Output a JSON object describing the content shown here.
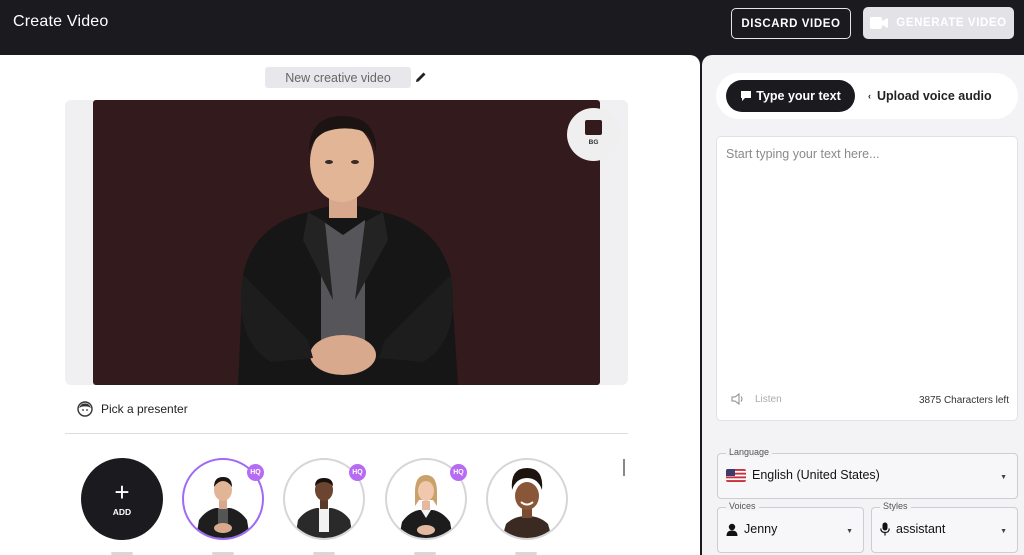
{
  "header": {
    "title": "Create Video",
    "discard_label": "DISCARD VIDEO",
    "generate_label": "GENERATE VIDEO"
  },
  "editor": {
    "video_title": "New creative video",
    "bg_button_label": "BG",
    "pick_presenter_label": "Pick a presenter",
    "add_label": "ADD"
  },
  "presenters": [
    {
      "name": "presenter-1",
      "hq": true,
      "selected": true
    },
    {
      "name": "presenter-2",
      "hq": true,
      "selected": false
    },
    {
      "name": "presenter-3",
      "hq": true,
      "selected": false
    },
    {
      "name": "presenter-4",
      "hq": false,
      "selected": false
    }
  ],
  "hq_badge": "HQ",
  "script_panel": {
    "tab_type_text": "Type your text",
    "tab_upload_audio": "Upload voice audio",
    "placeholder": "Start typing your text here...",
    "listen_label": "Listen",
    "characters_left": "3875 Characters left"
  },
  "settings": {
    "language_label": "Language",
    "language_value": "English (United States)",
    "voices_label": "Voices",
    "voice_value": "Jenny",
    "styles_label": "Styles",
    "style_value": "assistant"
  },
  "colors": {
    "topbar": "#1b1b1f",
    "stage_background": "#331b1d",
    "hq_badge": "#b66cf2",
    "selected_ring": "#a06af5"
  },
  "icons": [
    "pencil-icon",
    "face-icon",
    "plus-icon",
    "chat-icon",
    "upload-icon",
    "speaker-icon",
    "flag-us-icon",
    "person-icon",
    "mic-icon",
    "camera-icon",
    "caret-down-icon"
  ]
}
